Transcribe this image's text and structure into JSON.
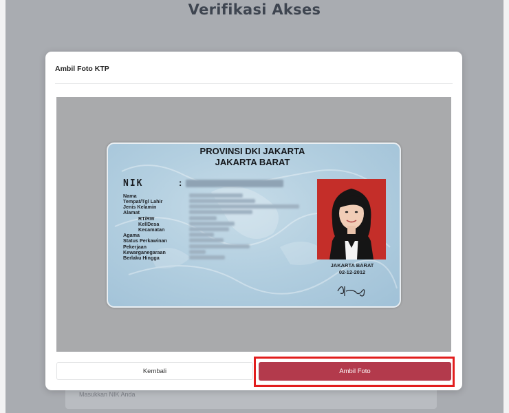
{
  "page": {
    "title": "Verifikasi Akses",
    "nik_input_placeholder": "Masukkan NIK Anda"
  },
  "modal": {
    "title": "Ambil Foto KTP",
    "buttons": {
      "back_label": "Kembali",
      "capture_label": "Ambil Foto"
    }
  },
  "ktp": {
    "province": "PROVINSI DKI JAKARTA",
    "city": "JAKARTA BARAT",
    "nik_label": "NIK",
    "nik_colon": ":",
    "fields": {
      "nama": "Nama",
      "ttl": "Tempat/Tgl Lahir",
      "jk": "Jenis Kelamin",
      "alamat": "Alamat",
      "rtrw": "RT/RW",
      "keldesa": "Kel/Desa",
      "kecamatan": "Kecamatan",
      "agama": "Agama",
      "status": "Status Perkawinan",
      "pekerjaan": "Pekerjaan",
      "kewarganegaraan": "Kewarganegaraan",
      "berlaku": "Berlaku Hingga"
    },
    "issue_place": "JAKARTA BARAT",
    "issue_date": "02-12-2012"
  },
  "colors": {
    "primary_button": "#b33a4c",
    "highlight_border": "#e21e1e",
    "backdrop": "#a9acb1"
  }
}
